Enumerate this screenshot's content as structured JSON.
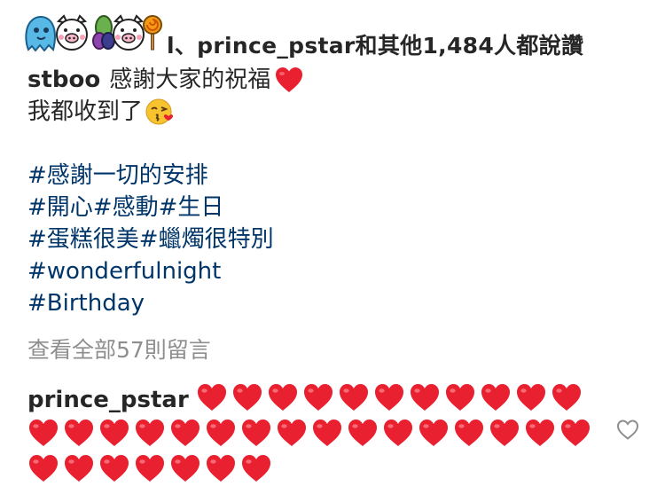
{
  "likes": {
    "text": "l、prince_pstar和其他1,484人都說讚",
    "stickers": [
      "blue-ghost-icon",
      "pig-face-icon",
      "candy-icon",
      "pig-face-icon",
      "lollipop-icon"
    ]
  },
  "caption": {
    "username": "stboo",
    "line1_text": "感謝大家的祝福",
    "line1_emoji": "red-heart-icon",
    "line2_text": "我都收到了",
    "line2_emoji": "kissing-face-icon",
    "hashtags": [
      "#感謝一切的安排",
      "#開心#感動#生日",
      "#蛋糕很美#蠟燭很特別",
      "#wonderfulnight",
      "#Birthday"
    ]
  },
  "view_all_comments": "查看全部57則留言",
  "comment": {
    "username": "prince_pstar",
    "heart_count": 34,
    "emoji": "red-heart-icon"
  },
  "colors": {
    "text": "#262626",
    "hashtag": "#003569",
    "muted": "#8e8e8e",
    "heart": "#e8202f"
  }
}
